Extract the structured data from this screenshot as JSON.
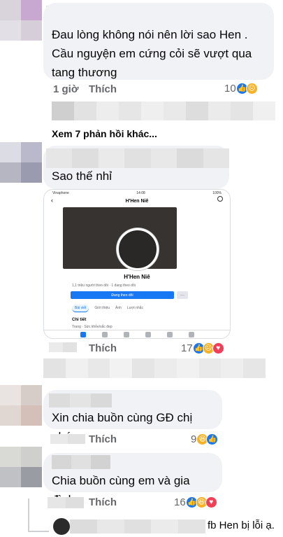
{
  "comments": [
    {
      "text": "Đau lòng không nói nên lời sao Hen .\nCầu nguyện em cứng cỏi sẽ vượt qua tang thương",
      "time": "1 giờ",
      "like_label": "Thích",
      "reaction_count": "10",
      "reactions": [
        "like-icon",
        "sad-icon"
      ]
    },
    {
      "text": "Sao thế nhỉ",
      "time": "",
      "like_label": "Thích",
      "reaction_count": "17",
      "reactions": [
        "like-icon",
        "sad-icon",
        "love-icon"
      ]
    },
    {
      "text": "Xin chia buồn cùng GĐ chị nhé",
      "time": "",
      "like_label": "Thích",
      "reaction_count": "9",
      "reactions": [
        "haha-icon",
        "like-icon"
      ]
    },
    {
      "text": "Chia buồn cùng em và gia đình",
      "time": "",
      "like_label": "Thích",
      "reaction_count": "16",
      "reactions": [
        "like-icon",
        "haha-icon",
        "love-icon"
      ]
    },
    {
      "text": "fb Hen bị lỗi ạ."
    }
  ],
  "more_replies_label": "Xem 7 phản hồi khác...",
  "profile_screenshot": {
    "name": "H'Hen Niê",
    "header_title": "H'Hen Niê",
    "stats": "1,1 triệu người theo dõi · 1 đang theo dõi",
    "follow_label": "Đang theo dõi",
    "more_label": "···",
    "tabs": [
      "Bài viết",
      "Giới thiệu",
      "Ảnh",
      "Lượt nhắc"
    ],
    "detail_title": "Chi tiết",
    "detail_line": "Trang · Sức khỏe/sắc đẹp",
    "status_left": "Vinaphone",
    "status_time": "14:08",
    "status_right": "100%"
  },
  "colors": {
    "bubble": "#f0f2f5",
    "meta": "#65676b",
    "like": "#1877f2",
    "love": "#f33e58",
    "sad": "#f7b125"
  }
}
